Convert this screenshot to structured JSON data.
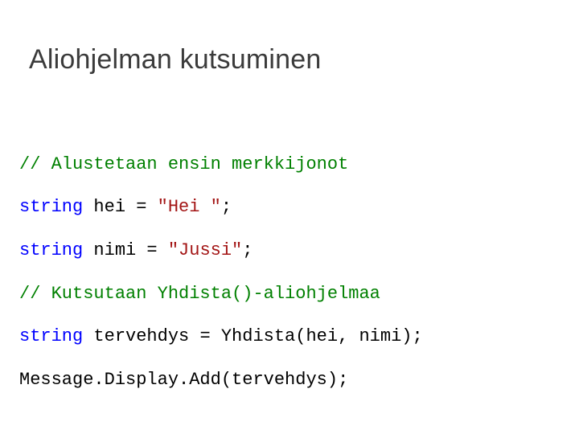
{
  "title": "Aliohjelman kutsuminen",
  "code": {
    "l1": {
      "comment": "// Alustetaan ensin merkkijonot"
    },
    "l2": {
      "kw": "string",
      "rest_a": " hei = ",
      "str": "\"Hei \"",
      "rest_b": ";"
    },
    "l3": {
      "kw": "string",
      "rest_a": " nimi = ",
      "str": "\"Jussi\"",
      "rest_b": ";"
    },
    "l4": {
      "comment": "// Kutsutaan Yhdista()-aliohjelmaa"
    },
    "l5": {
      "kw": "string",
      "rest": " tervehdys = Yhdista(hei, nimi);"
    },
    "l6": {
      "rest": "Message.Display.Add(tervehdys);"
    }
  }
}
